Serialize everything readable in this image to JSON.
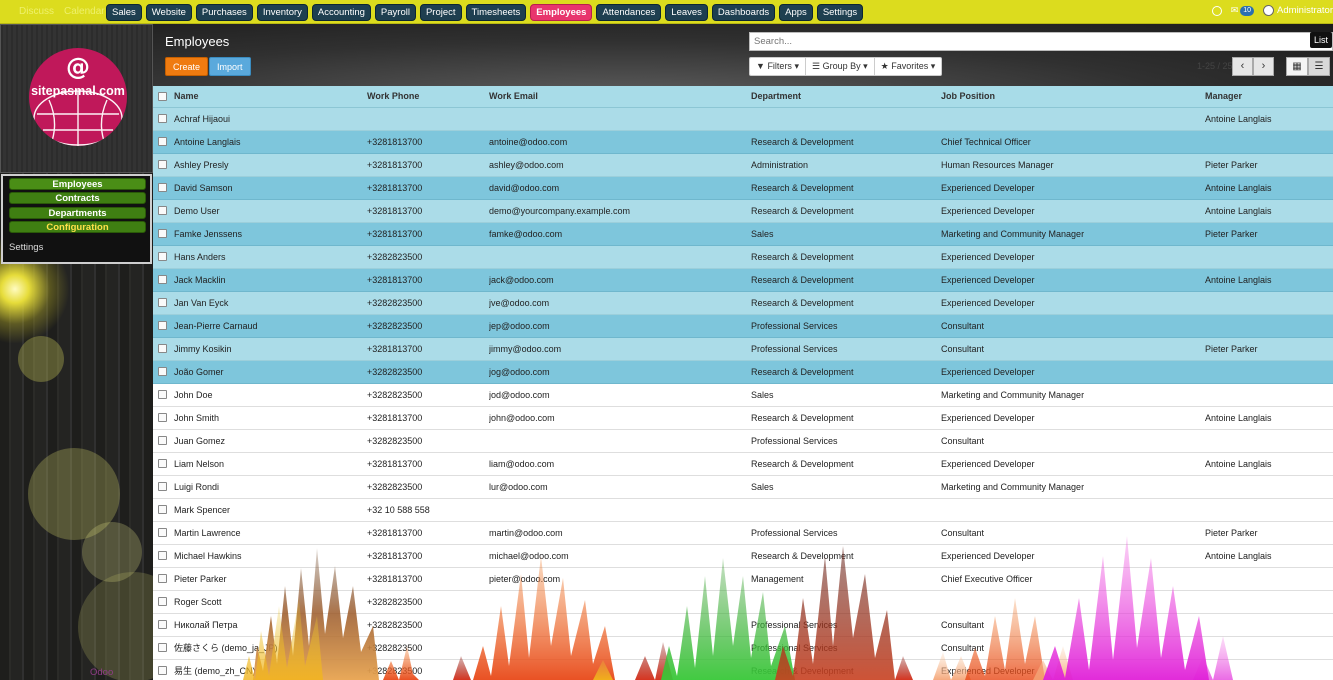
{
  "topbar": {
    "faded_left": [
      "Discuss",
      "Calendar"
    ],
    "menu": [
      "Sales",
      "Website",
      "Purchases",
      "Inventory",
      "Accounting",
      "Payroll",
      "Project",
      "Timesheets",
      "Employees",
      "Attendances",
      "Leaves",
      "Dashboards",
      "Apps",
      "Settings"
    ],
    "active_menu": "Employees",
    "message_count": "10",
    "user": "Administrator",
    "colors": {
      "bar": "#dcdc1e",
      "menu_btn": "#1e3f50",
      "menu_active": "#e8356d"
    }
  },
  "sidebar": {
    "logo_text": "sitepasmal.com",
    "logo_symbol": "@",
    "items": [
      "Employees",
      "Contracts",
      "Departments",
      "Configuration"
    ],
    "settings": "Settings",
    "footer": "Odoo"
  },
  "control_panel": {
    "title": "Employees",
    "create": "Create",
    "import": "Import",
    "search_placeholder": "Search...",
    "filters": "Filters",
    "group_by": "Group By",
    "favorites": "Favorites",
    "pager": "1-25 / 25",
    "tooltip": "List",
    "icons": {
      "prev": "chevron-left-icon",
      "next": "chevron-right-icon",
      "kanban": "grid-icon",
      "list": "list-icon"
    }
  },
  "list": {
    "columns": [
      "Name",
      "Work Phone",
      "Work Email",
      "Department",
      "Job Position",
      "Manager"
    ],
    "rows": [
      {
        "name": "Achraf Hijaoui",
        "phone": "",
        "email": "",
        "dept": "",
        "job": "",
        "manager": "Antoine Langlais"
      },
      {
        "name": "Antoine Langlais",
        "phone": "+3281813700",
        "email": "antoine@odoo.com",
        "dept": "Research & Development",
        "job": "Chief Technical Officer",
        "manager": ""
      },
      {
        "name": "Ashley Presly",
        "phone": "+3281813700",
        "email": "ashley@odoo.com",
        "dept": "Administration",
        "job": "Human Resources Manager",
        "manager": "Pieter Parker"
      },
      {
        "name": "David Samson",
        "phone": "+3281813700",
        "email": "david@odoo.com",
        "dept": "Research & Development",
        "job": "Experienced Developer",
        "manager": "Antoine Langlais"
      },
      {
        "name": "Demo User",
        "phone": "+3281813700",
        "email": "demo@yourcompany.example.com",
        "dept": "Research & Development",
        "job": "Experienced Developer",
        "manager": "Antoine Langlais"
      },
      {
        "name": "Famke Jenssens",
        "phone": "+3281813700",
        "email": "famke@odoo.com",
        "dept": "Sales",
        "job": "Marketing and Community Manager",
        "manager": "Pieter Parker"
      },
      {
        "name": "Hans Anders",
        "phone": "+3282823500",
        "email": "",
        "dept": "Research & Development",
        "job": "Experienced Developer",
        "manager": ""
      },
      {
        "name": "Jack Macklin",
        "phone": "+3281813700",
        "email": "jack@odoo.com",
        "dept": "Research & Development",
        "job": "Experienced Developer",
        "manager": "Antoine Langlais"
      },
      {
        "name": "Jan Van Eyck",
        "phone": "+3282823500",
        "email": "jve@odoo.com",
        "dept": "Research & Development",
        "job": "Experienced Developer",
        "manager": ""
      },
      {
        "name": "Jean-Pierre Carnaud",
        "phone": "+3282823500",
        "email": "jep@odoo.com",
        "dept": "Professional Services",
        "job": "Consultant",
        "manager": ""
      },
      {
        "name": "Jimmy Kosikin",
        "phone": "+3281813700",
        "email": "jimmy@odoo.com",
        "dept": "Professional Services",
        "job": "Consultant",
        "manager": "Pieter Parker"
      },
      {
        "name": "João Gomer",
        "phone": "+3282823500",
        "email": "jog@odoo.com",
        "dept": "Research & Development",
        "job": "Experienced Developer",
        "manager": ""
      },
      {
        "name": "John Doe",
        "phone": "+3282823500",
        "email": "jod@odoo.com",
        "dept": "Sales",
        "job": "Marketing and Community Manager",
        "manager": ""
      },
      {
        "name": "John Smith",
        "phone": "+3281813700",
        "email": "john@odoo.com",
        "dept": "Research & Development",
        "job": "Experienced Developer",
        "manager": "Antoine Langlais"
      },
      {
        "name": "Juan Gomez",
        "phone": "+3282823500",
        "email": "",
        "dept": "Professional Services",
        "job": "Consultant",
        "manager": ""
      },
      {
        "name": "Liam Nelson",
        "phone": "+3281813700",
        "email": "liam@odoo.com",
        "dept": "Research & Development",
        "job": "Experienced Developer",
        "manager": "Antoine Langlais"
      },
      {
        "name": "Luigi Rondi",
        "phone": "+3282823500",
        "email": "lur@odoo.com",
        "dept": "Sales",
        "job": "Marketing and Community Manager",
        "manager": ""
      },
      {
        "name": "Mark Spencer",
        "phone": "+32 10 588 558",
        "email": "",
        "dept": "",
        "job": "",
        "manager": ""
      },
      {
        "name": "Martin Lawrence",
        "phone": "+3281813700",
        "email": "martin@odoo.com",
        "dept": "Professional Services",
        "job": "Consultant",
        "manager": "Pieter Parker"
      },
      {
        "name": "Michael Hawkins",
        "phone": "+3281813700",
        "email": "michael@odoo.com",
        "dept": "Research & Development",
        "job": "Experienced Developer",
        "manager": "Antoine Langlais"
      },
      {
        "name": "Pieter Parker",
        "phone": "+3281813700",
        "email": "pieter@odoo.com",
        "dept": "Management",
        "job": "Chief Executive Officer",
        "manager": ""
      },
      {
        "name": "Roger Scott",
        "phone": "+3282823500",
        "email": "",
        "dept": "",
        "job": "",
        "manager": ""
      },
      {
        "name": "Николай Петра",
        "phone": "+3282823500",
        "email": "",
        "dept": "Professional Services",
        "job": "Consultant",
        "manager": ""
      },
      {
        "name": "佐藤さくら (demo_ja_JP)",
        "phone": "+3282823500",
        "email": "",
        "dept": "Professional Services",
        "job": "Consultant",
        "manager": ""
      },
      {
        "name": "易生 (demo_zh_CN)",
        "phone": "+3282823500",
        "email": "",
        "dept": "Research & Development",
        "job": "Experienced Developer",
        "manager": ""
      }
    ]
  }
}
